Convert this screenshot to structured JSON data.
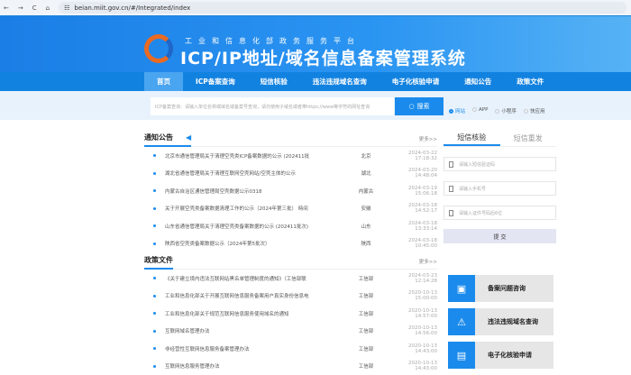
{
  "browser": {
    "url": "beian.miit.gov.cn/#/Integrated/index"
  },
  "header": {
    "subtitle": "工业和信息化部政务服务平台",
    "title": "ICP/IP地址/域名信息备案管理系统"
  },
  "nav": [
    "首页",
    "ICP备案查询",
    "短信核验",
    "违法违规域名查询",
    "电子化核验申请",
    "通知公告",
    "政策文件"
  ],
  "search": {
    "placeholder": "ICP备案查询：请输入单位名称或域名或备案号查询，请勿使用子域名或者带https://www等字符的网址查询",
    "button": "搜索",
    "types": [
      "网站",
      "APP",
      "小程序",
      "快应用"
    ]
  },
  "notices": {
    "title": "通知公告",
    "more": "更多>>",
    "items": [
      {
        "t": "北京市通信管理局关于清理空壳类ICP备案数据的公示 (202411批",
        "r": "北京",
        "d": "2024-03-22 17:18:32"
      },
      {
        "t": "湖北省通信管理局关于清理互联网空壳网站/空壳主体的公示",
        "r": "湖北",
        "d": "2024-03-20 14:48:04"
      },
      {
        "t": "内蒙古自治区通信管理局空壳数据公示0318",
        "r": "内蒙古",
        "d": "2024-03-19 15:06:18"
      },
      {
        "t": "关于开展空壳类备案数据清理工作的公示（2024年第三批） 時间",
        "r": "安徽",
        "d": "2024-03-18 14:52:17"
      },
      {
        "t": "山东省通信管理局关于清理空壳类备案数据的公示 (202411批次)",
        "r": "山东",
        "d": "2024-03-18 13:33:14"
      },
      {
        "t": "陕西省空壳类备案数据公示（2024年第5批次）",
        "r": "陕西",
        "d": "2024-03-18 10:45:00"
      }
    ]
  },
  "policies": {
    "title": "政策文件",
    "more": "更多>>",
    "items": [
      {
        "t": "《关于建立境内违法互联网站黑名单管理制度的通知》（工信部联",
        "r": "工信部",
        "d": "2024-03-23 12:14:28"
      },
      {
        "t": "工业和信息化部关于开展互联网信息服务备案用户真实身份信息电",
        "r": "工信部",
        "d": "2020-10-13 15:00:00"
      },
      {
        "t": "工业和信息化部关于规范互联网信息服务使用域名的通知",
        "r": "工信部",
        "d": "2020-10-13 14:57:00"
      },
      {
        "t": "互联网域名管理办法",
        "r": "工信部",
        "d": "2020-10-13 14:56:00"
      },
      {
        "t": "非经营性互联网信息服务备案管理办法",
        "r": "工信部",
        "d": "2020-10-13 14:43:00"
      },
      {
        "t": "互联网信息服务管理办法",
        "r": "工信部",
        "d": "2020-10-13 14:43:00"
      }
    ]
  },
  "sms": {
    "tabs": [
      "短信核验",
      "短信重发"
    ],
    "fields": [
      "请输入短信验证码",
      "请输入手机号",
      "请输入证件号码后6位"
    ],
    "submit": "提 交"
  },
  "quick": [
    {
      "label": "备案问题咨询",
      "icon": "▣"
    },
    {
      "label": "违法违规域名查询",
      "icon": "⚠"
    },
    {
      "label": "电子化核验申请",
      "icon": "▤"
    }
  ]
}
